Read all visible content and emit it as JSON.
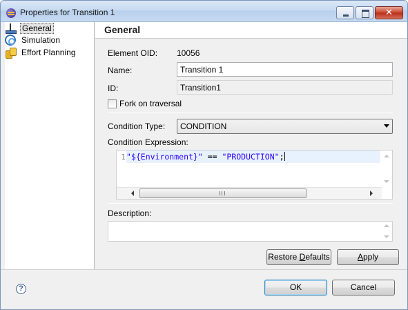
{
  "window": {
    "title": "Properties for Transition 1"
  },
  "tree": {
    "items": [
      {
        "label": "General",
        "icon": "general-icon",
        "selected": true
      },
      {
        "label": "Simulation",
        "icon": "simulation-icon",
        "selected": false
      },
      {
        "label": "Effort Planning",
        "icon": "effort-planning-icon",
        "selected": false
      }
    ]
  },
  "panel": {
    "title": "General",
    "element_oid_label": "Element OID:",
    "element_oid_value": "10056",
    "name_label": "Name:",
    "name_value": "Transition 1",
    "id_label": "ID:",
    "id_value": "Transition1",
    "fork_label": "Fork on traversal",
    "fork_checked": false,
    "condition_type_label": "Condition Type:",
    "condition_type_value": "CONDITION",
    "condition_expression_label": "Condition Expression:",
    "code": {
      "line_number": "1",
      "part1": "\"${Environment}\"",
      "part2": " == ",
      "part3": "\"PRODUCTION\"",
      "part4": ";"
    },
    "hscroll_grip": "III",
    "description_label": "Description:",
    "description_value": "",
    "restore_defaults": {
      "before": "Restore ",
      "underline": "D",
      "after": "efaults"
    },
    "apply": {
      "underline": "A",
      "after": "pply"
    }
  },
  "footer": {
    "help_glyph": "?",
    "ok_label": "OK",
    "cancel_label": "Cancel"
  },
  "colors": {
    "code_string": "#2a00ff",
    "current_line": "#e8f2fe",
    "titlebar": "#c7daf1"
  }
}
